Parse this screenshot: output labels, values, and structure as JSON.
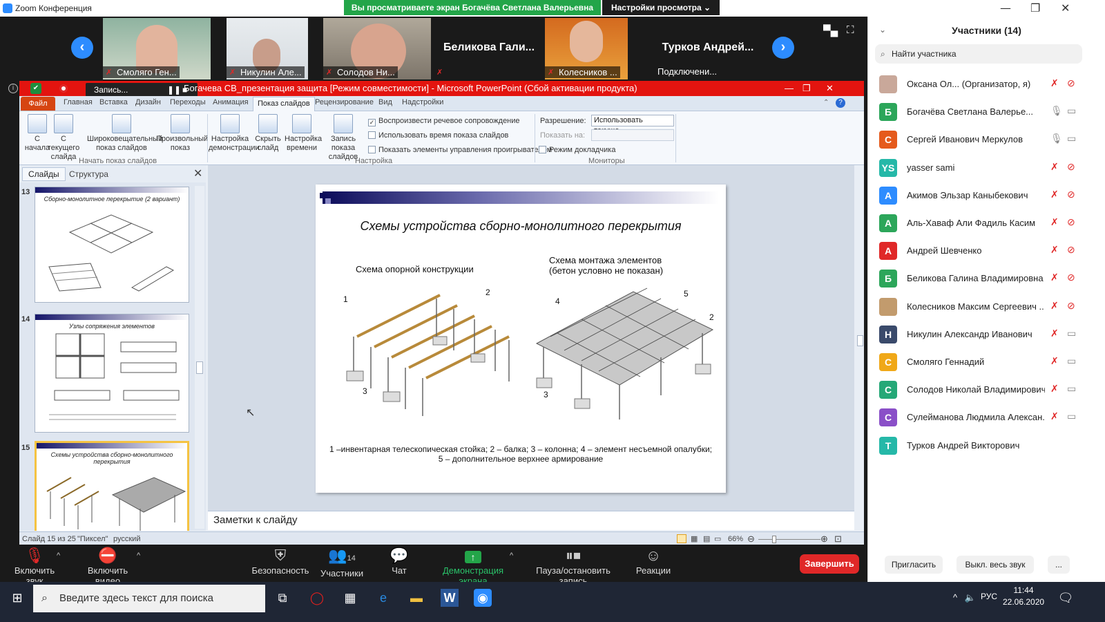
{
  "window": {
    "app_name": "Zoom Конференция",
    "share_banner": "Вы просматриваете экран Богачёва Светлана Валерьевна",
    "view_settings": "Настройки просмотра",
    "minimize": "—",
    "maximize": "❐",
    "close": "✕"
  },
  "video_tiles": [
    {
      "name": "Смоляго Ген..."
    },
    {
      "name": "Никулин Але..."
    },
    {
      "name": "Солодов Ни..."
    },
    {
      "name": "Беликова Гали..."
    },
    {
      "name": "Колесников ..."
    },
    {
      "name": "Турков Андрей...",
      "sub": "Подключени..."
    }
  ],
  "powerpoint": {
    "recording_label": "Запись...",
    "title": "Богачева СВ_презентация защита [Режим совместимости] - Microsoft PowerPoint (Сбой активации продукта)",
    "tabs": [
      "Файл",
      "Главная",
      "Вставка",
      "Дизайн",
      "Переходы",
      "Анимация",
      "Показ слайдов",
      "Рецензирование",
      "Вид",
      "Надстройки"
    ],
    "ribbon": {
      "btn_start": "С начала",
      "btn_current": "С текущего слайда",
      "btn_broadcast": "Широковещательный показ слайдов",
      "btn_custom": "Произвольный показ",
      "btn_setup": "Настройка демонстрации",
      "btn_hide": "Скрыть слайд",
      "btn_timings": "Настройка времени",
      "btn_record": "Запись показа слайдов",
      "chk_narration": "Воспроизвести речевое сопровождение",
      "chk_timings": "Использовать время показа слайдов",
      "chk_media": "Показать элементы управления проигрывателем",
      "resolution_label": "Разрешение:",
      "resolution_value": "Использовать текуще...",
      "show_on_label": "Показать на:",
      "presenter_view": "Режим докладчика",
      "group_start": "Начать показ слайдов",
      "group_setup": "Настройка",
      "group_monitors": "Мониторы"
    },
    "pane_tabs": {
      "slides": "Слайды",
      "outline": "Структура"
    },
    "thumbs": [
      {
        "num": "13",
        "title": "Сборно-монолитное перекрытие (2 вариант)"
      },
      {
        "num": "14",
        "title": "Узлы сопряжения элементов"
      },
      {
        "num": "15",
        "title": "Схемы устройства сборно-монолитного перекрытия"
      }
    ],
    "slide": {
      "title": "Схемы устройства сборно-монолитного перекрытия",
      "sub_left": "Схема опорной конструкции",
      "sub_right_1": "Схема монтажа элементов",
      "sub_right_2": "(бетон условно не показан)",
      "legend_1": "1 –инвентарная телескопическая стойка; 2 – балка; 3 – колонна; 4 – элемент несъемной опалубки;",
      "legend_2": "5 – дополнительное верхнее армирование",
      "labels": [
        "1",
        "2",
        "3",
        "4",
        "5",
        "2",
        "3"
      ]
    },
    "notes": "Заметки к слайду",
    "status": {
      "slide_of": "Слайд 15 из 25",
      "theme": "\"Пиксел\"",
      "lang": "русский",
      "zoom": "66%"
    }
  },
  "toolbar": {
    "unmute": "Включить звук",
    "start_video": "Включить видео",
    "security": "Безопасность",
    "participants": "Участники",
    "participants_count": "14",
    "chat": "Чат",
    "share": "Демонстрация экрана",
    "pause_record": "Пауза/остановить запись",
    "reactions": "Реакции",
    "end": "Завершить"
  },
  "panel": {
    "title": "Участники (14)",
    "search_placeholder": "Найти участника",
    "participants": [
      {
        "initial": "",
        "name": "Оксана Ол... (Организатор, я)",
        "color": "#c9a89a",
        "mic": "muted",
        "cam": "off"
      },
      {
        "initial": "Б",
        "name": "Богачёва Светлана Валерье...",
        "color": "#2ca65a",
        "mic": "on",
        "cam": "on"
      },
      {
        "initial": "С",
        "name": "Сергей Иванович Меркулов",
        "color": "#e55a1c",
        "mic": "on",
        "cam": "on"
      },
      {
        "initial": "YS",
        "name": "yasser sami",
        "color": "#25b8a8",
        "mic": "muted",
        "cam": "off"
      },
      {
        "initial": "А",
        "name": "Акимов Эльзар Каныбекович",
        "color": "#2d8cff",
        "mic": "muted",
        "cam": "off"
      },
      {
        "initial": "А",
        "name": "Аль-Хаваф Али Фадиль Касим",
        "color": "#2ca65a",
        "mic": "muted",
        "cam": "off"
      },
      {
        "initial": "А",
        "name": "Андрей Шевченко",
        "color": "#e02828",
        "mic": "muted",
        "cam": "off"
      },
      {
        "initial": "Б",
        "name": "Беликова Галина Владимировна",
        "color": "#2ca65a",
        "mic": "muted",
        "cam": "off"
      },
      {
        "initial": "",
        "name": "Колесников Максим Сергеевич ...",
        "color": "#c29b6d",
        "mic": "muted",
        "cam": "off"
      },
      {
        "initial": "Н",
        "name": "Никулин Александр Иванович",
        "color": "#3a4a6b",
        "mic": "muted",
        "cam": "on"
      },
      {
        "initial": "С",
        "name": "Смоляго Геннадий",
        "color": "#f0a818",
        "mic": "muted",
        "cam": "on"
      },
      {
        "initial": "С",
        "name": "Солодов Николай Владимирович",
        "color": "#25a877",
        "mic": "muted",
        "cam": "on"
      },
      {
        "initial": "С",
        "name": "Сулейманова Людмила Алексан...",
        "color": "#8a4fc8",
        "mic": "muted",
        "cam": "on"
      },
      {
        "initial": "Т",
        "name": "Турков Андрей Викторович",
        "color": "#25b8a8",
        "mic": "none",
        "cam": "none"
      }
    ],
    "invite": "Пригласить",
    "mute_all": "Выкл. весь звук",
    "more": "..."
  },
  "taskbar": {
    "search_placeholder": "Введите здесь текст для поиска",
    "lang": "РУС",
    "time": "11:44",
    "date": "22.06.2020"
  }
}
